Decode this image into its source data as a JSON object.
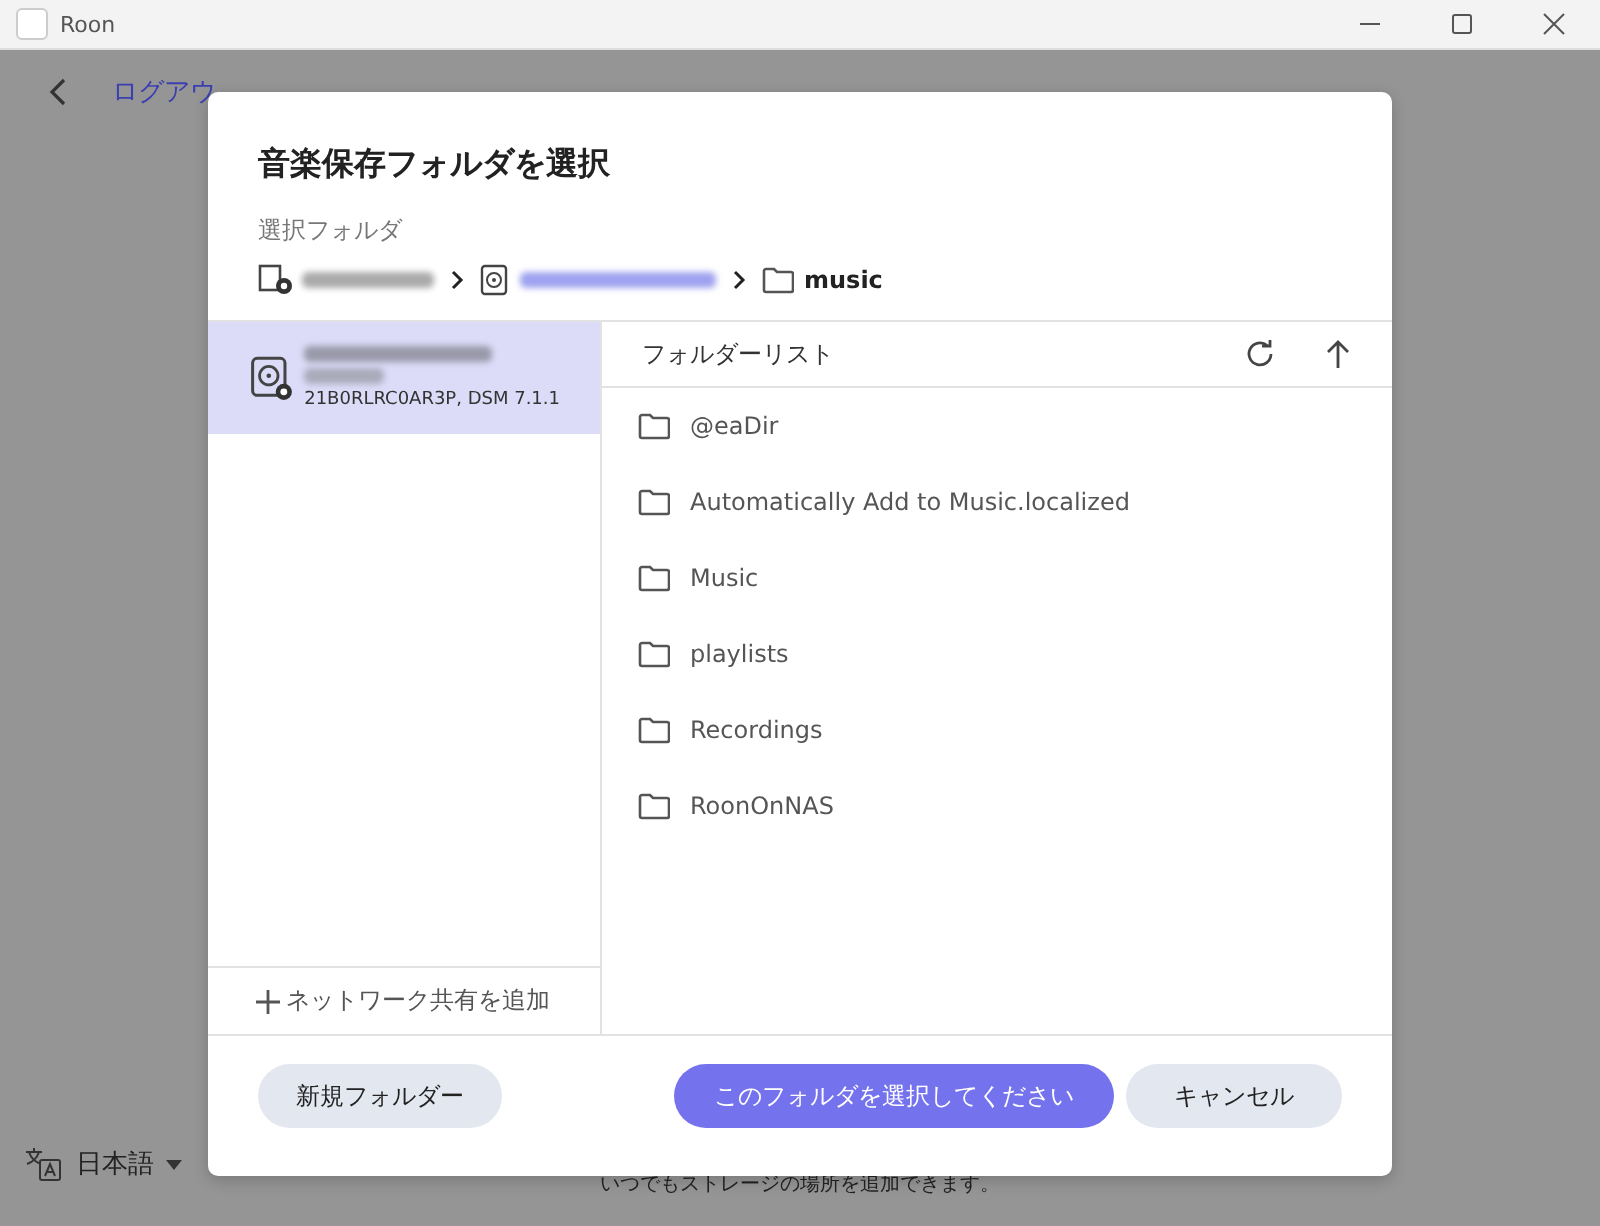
{
  "window": {
    "title": "Roon"
  },
  "background": {
    "back_link": "ログアウ",
    "language": "日本語",
    "hint": "いつでもストレージの場所を追加できます。"
  },
  "dialog": {
    "title": "音楽保存フォルダを選択",
    "selected_label": "選択フォルダ",
    "breadcrumb": [
      {
        "kind": "server"
      },
      {
        "kind": "drive"
      },
      {
        "kind": "folder",
        "label": "music"
      }
    ],
    "sources": [
      {
        "detail": "21B0RLRC0AR3P, DSM 7.1.1",
        "selected": true
      }
    ],
    "add_share": "ネットワーク共有を追加",
    "list_title": "フォルダーリスト",
    "folders": [
      {
        "name": "@eaDir"
      },
      {
        "name": "Automatically Add to Music.localized"
      },
      {
        "name": "Music"
      },
      {
        "name": "playlists"
      },
      {
        "name": "Recordings"
      },
      {
        "name": "RoonOnNAS"
      }
    ],
    "buttons": {
      "new_folder": "新規フォルダー",
      "confirm": "このフォルダを選択してください",
      "cancel": "キャンセル"
    }
  }
}
